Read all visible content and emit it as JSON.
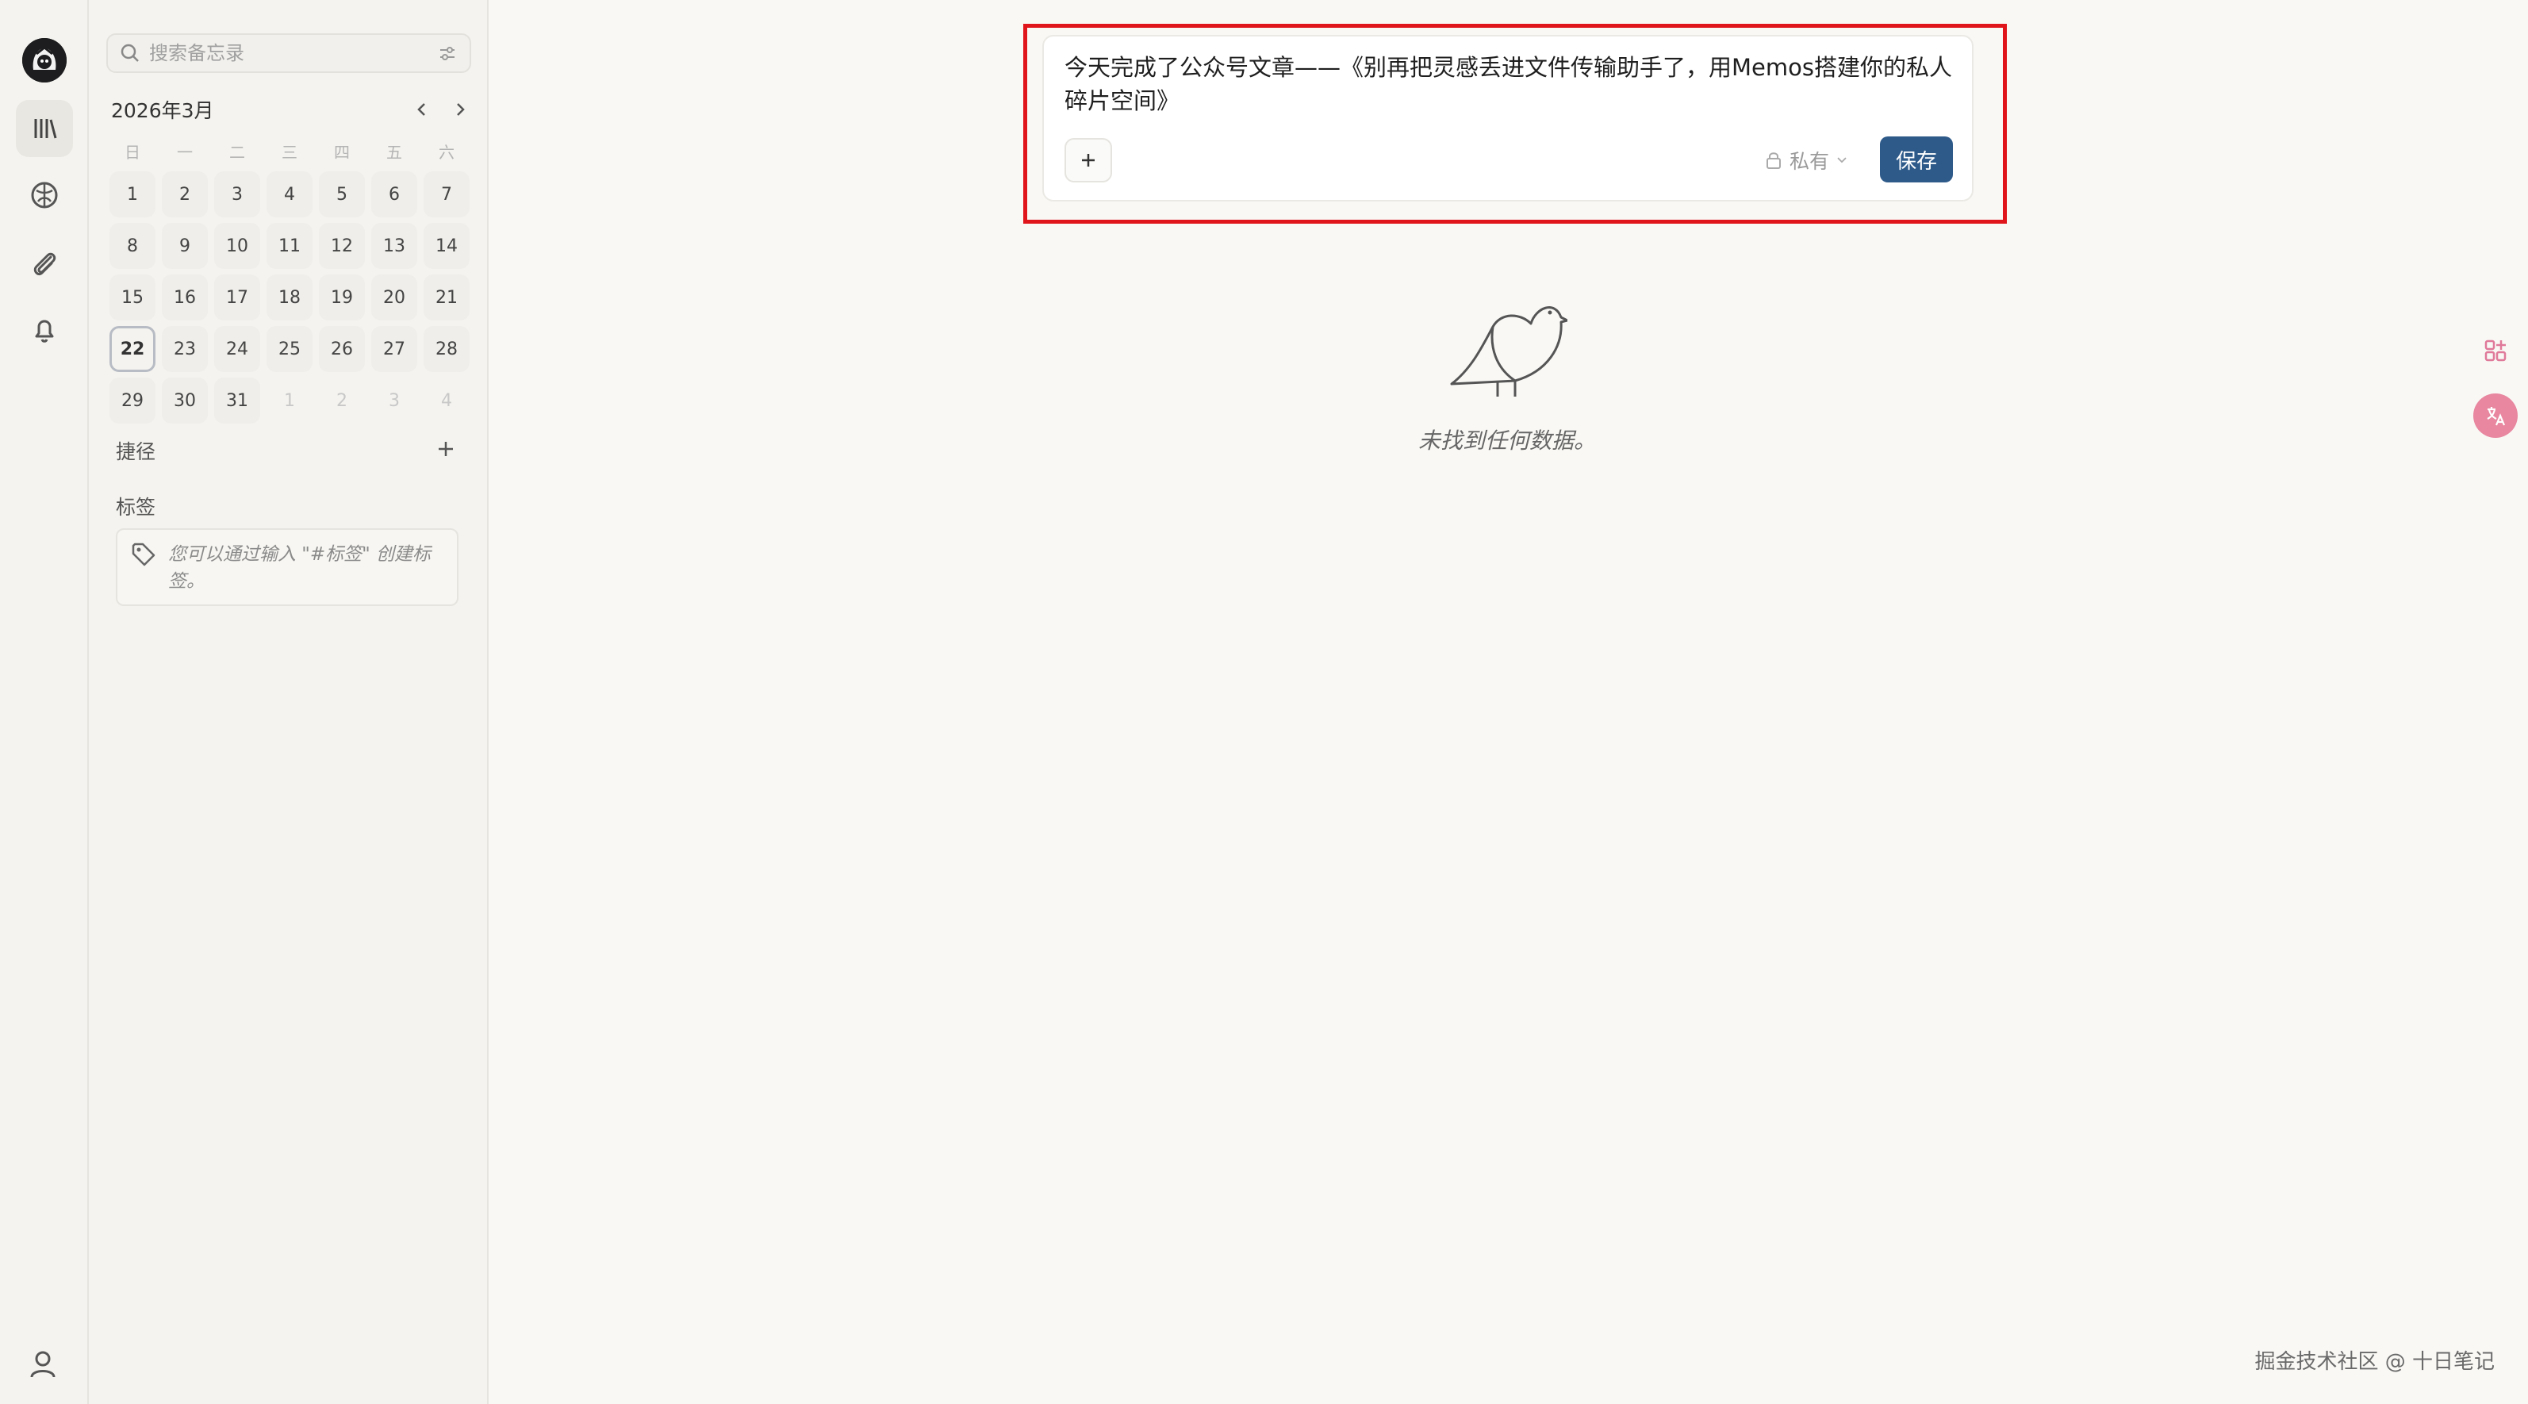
{
  "rail": {
    "logo_icon": "memos-avatar-logo",
    "items": [
      {
        "name": "memos-icon",
        "active": true
      },
      {
        "name": "explore-icon",
        "active": false
      },
      {
        "name": "attachment-icon",
        "active": false
      },
      {
        "name": "notification-bell-icon",
        "active": false
      }
    ],
    "user_icon": "user-icon"
  },
  "sidebar": {
    "search": {
      "placeholder": "搜索备忘录",
      "value": ""
    },
    "calendar": {
      "month_label": "2026年3月",
      "weekdays": [
        "日",
        "一",
        "二",
        "三",
        "四",
        "五",
        "六"
      ],
      "days": [
        {
          "label": "1",
          "muted": false
        },
        {
          "label": "2",
          "muted": false
        },
        {
          "label": "3",
          "muted": false
        },
        {
          "label": "4",
          "muted": false
        },
        {
          "label": "5",
          "muted": false
        },
        {
          "label": "6",
          "muted": false
        },
        {
          "label": "7",
          "muted": false
        },
        {
          "label": "8",
          "muted": false
        },
        {
          "label": "9",
          "muted": false
        },
        {
          "label": "10",
          "muted": false
        },
        {
          "label": "11",
          "muted": false
        },
        {
          "label": "12",
          "muted": false
        },
        {
          "label": "13",
          "muted": false
        },
        {
          "label": "14",
          "muted": false
        },
        {
          "label": "15",
          "muted": false
        },
        {
          "label": "16",
          "muted": false
        },
        {
          "label": "17",
          "muted": false
        },
        {
          "label": "18",
          "muted": false
        },
        {
          "label": "19",
          "muted": false
        },
        {
          "label": "20",
          "muted": false
        },
        {
          "label": "21",
          "muted": false
        },
        {
          "label": "22",
          "muted": false,
          "today": true
        },
        {
          "label": "23",
          "muted": false
        },
        {
          "label": "24",
          "muted": false
        },
        {
          "label": "25",
          "muted": false
        },
        {
          "label": "26",
          "muted": false
        },
        {
          "label": "27",
          "muted": false
        },
        {
          "label": "28",
          "muted": false
        },
        {
          "label": "29",
          "muted": false
        },
        {
          "label": "30",
          "muted": false
        },
        {
          "label": "31",
          "muted": false
        },
        {
          "label": "1",
          "muted": true
        },
        {
          "label": "2",
          "muted": true
        },
        {
          "label": "3",
          "muted": true
        },
        {
          "label": "4",
          "muted": true
        }
      ]
    },
    "shortcuts_title": "捷径",
    "tags_title": "标签",
    "tags_hint": "您可以通过输入 \"#标签\" 创建标签。"
  },
  "editor": {
    "content": "今天完成了公众号文章——《别再把灵感丢进文件传输助手了，用Memos搭建你的私人碎片空间》",
    "visibility_label": "私有",
    "save_label": "保存",
    "highlight_color": "#e0151b",
    "save_color": "#2e5a8a"
  },
  "empty_state": {
    "text": "未找到任何数据。",
    "icon": "bird-icon"
  },
  "watermark": "掘金技术社区 @ 十日笔记"
}
